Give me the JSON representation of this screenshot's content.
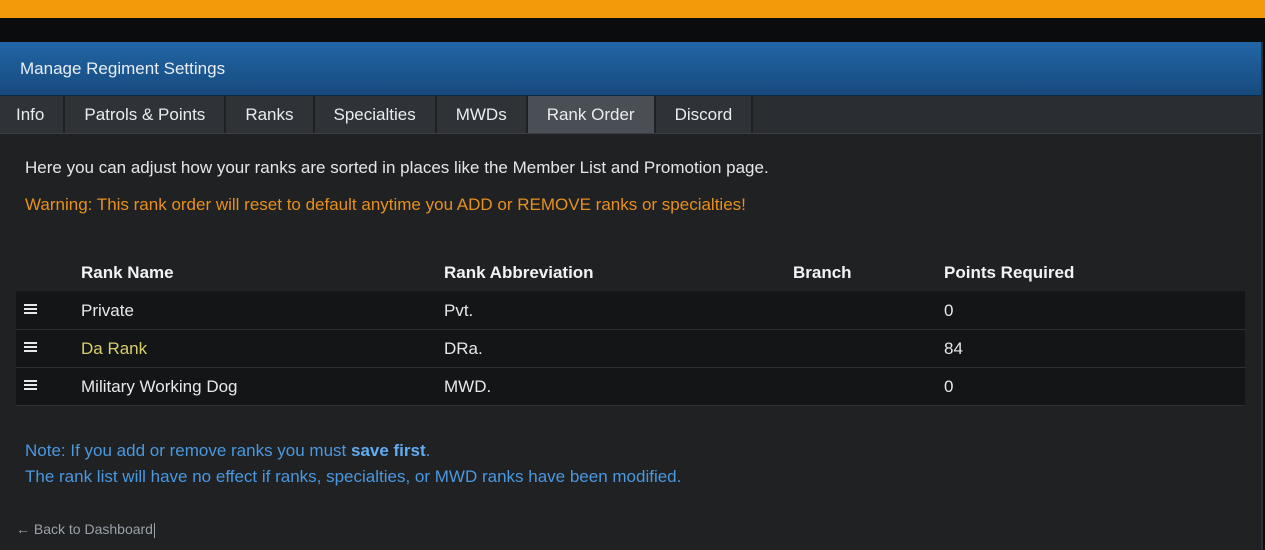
{
  "colors": {
    "banner": "#f39a0b",
    "header_gradient_top": "#2166a6",
    "warning_text": "#e8901c",
    "note_text": "#4a98e0",
    "highlight_rank": "#d8cf6a"
  },
  "panel": {
    "title": "Manage Regiment Settings"
  },
  "tabs": [
    {
      "label": "Info",
      "active": false
    },
    {
      "label": "Patrols & Points",
      "active": false
    },
    {
      "label": "Ranks",
      "active": false
    },
    {
      "label": "Specialties",
      "active": false
    },
    {
      "label": "MWDs",
      "active": false
    },
    {
      "label": "Rank Order",
      "active": true
    },
    {
      "label": "Discord",
      "active": false
    }
  ],
  "intro_text": "Here you can adjust how your ranks are sorted in places like the Member List and Promotion page.",
  "warning_text": "Warning: This rank order will reset to default anytime you ADD or REMOVE ranks or specialties!",
  "table": {
    "headers": {
      "handle": "",
      "name": "Rank Name",
      "abbr": "Rank Abbreviation",
      "branch": "Branch",
      "points": "Points Required"
    },
    "rows": [
      {
        "name": "Private",
        "abbr": "Pvt.",
        "branch": "",
        "points": "0",
        "handle_icon": "drag-handle-icon"
      },
      {
        "name": "Da Rank",
        "abbr": "DRa.",
        "branch": "",
        "points": "84",
        "handle_icon": "drag-handle-icon"
      },
      {
        "name": "Military Working Dog",
        "abbr": "MWD.",
        "branch": "",
        "points": "0",
        "handle_icon": "drag-handle-icon"
      }
    ]
  },
  "note": {
    "prefix": "Note: If you add or remove ranks you must ",
    "bold": "save first",
    "suffix": ".",
    "line2": "The rank list will have no effect if ranks, specialties, or MWD ranks have been modified."
  },
  "back_link": {
    "arrow": "←",
    "label": "Back to Dashboard"
  }
}
